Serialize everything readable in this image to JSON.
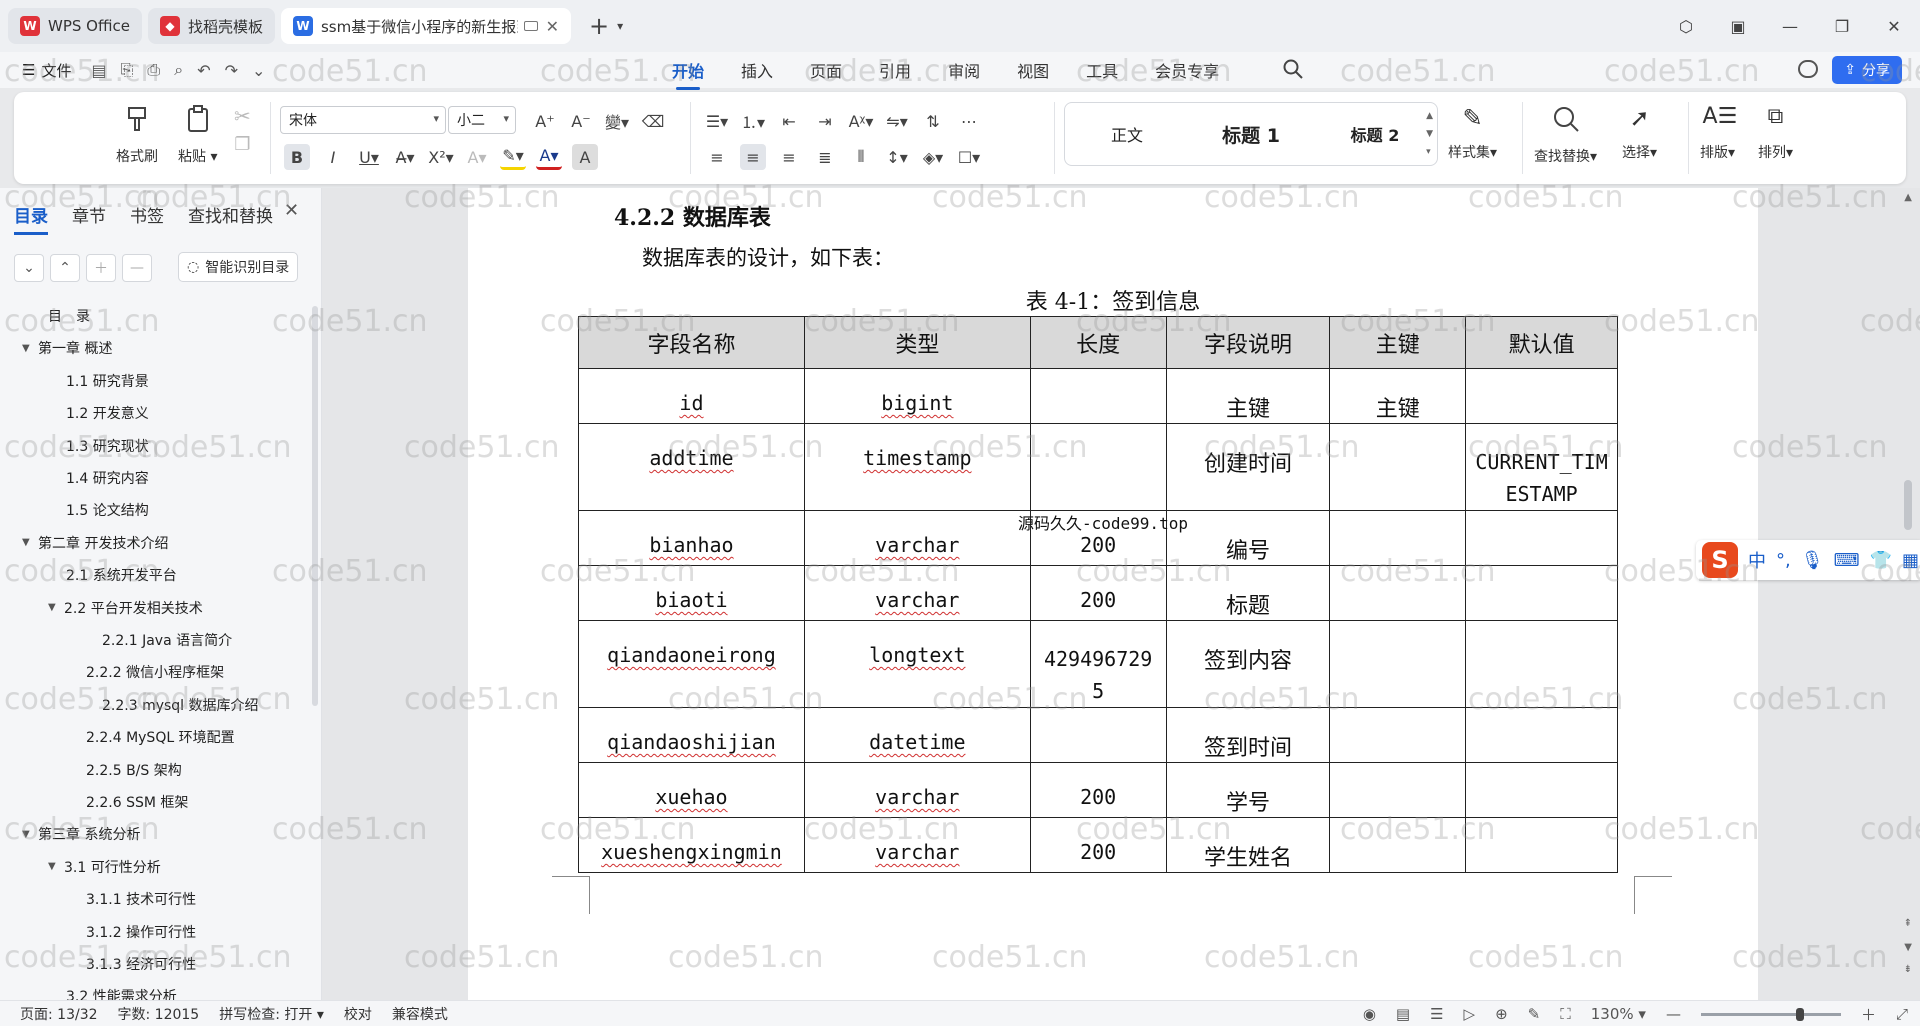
{
  "tabs": [
    {
      "title": "WPS Office",
      "icon_color": "#e0333a",
      "icon": "W"
    },
    {
      "title": "找稻壳模板",
      "icon_color": "#e0333a",
      "icon": "◆"
    },
    {
      "title": "ssm基于微信小程序的新生报到",
      "icon_color": "#2b6de3",
      "icon": "W"
    }
  ],
  "menu": {
    "file": "文件",
    "ribbon_tabs": [
      "开始",
      "插入",
      "页面",
      "引用",
      "审阅",
      "视图",
      "工具",
      "会员专享"
    ],
    "share": "分享"
  },
  "ribbon": {
    "format_painter": "格式刷",
    "paste": "粘贴",
    "font_name": "宋体",
    "font_size": "小二",
    "styles": [
      "正文",
      "标题 1",
      "标题 2"
    ],
    "style_set": "样式集",
    "find_replace": "查找替换",
    "select": "选择",
    "layout": "排版",
    "arrange": "排列"
  },
  "sidebar": {
    "tabs": [
      "目录",
      "章节",
      "书签",
      "查找和替换"
    ],
    "smart_toc": "智能识别目录",
    "toc": [
      {
        "label": "目　录",
        "level": 0,
        "arrow": ""
      },
      {
        "label": "第一章  概述",
        "level": 0,
        "arrow": "▼"
      },
      {
        "label": "1.1  研究背景",
        "level": 1,
        "arrow": ""
      },
      {
        "label": "1.2  开发意义",
        "level": 1,
        "arrow": ""
      },
      {
        "label": "1.3  研究现状",
        "level": 1,
        "arrow": ""
      },
      {
        "label": "1.4  研究内容",
        "level": 1,
        "arrow": ""
      },
      {
        "label": "1.5  论文结构",
        "level": 1,
        "arrow": ""
      },
      {
        "label": "第二章  开发技术介绍",
        "level": 0,
        "arrow": "▼"
      },
      {
        "label": "2.1  系统开发平台",
        "level": 1,
        "arrow": ""
      },
      {
        "label": "2.2  平台开发相关技术",
        "level": 1,
        "arrow": "▼"
      },
      {
        "label": "2.2.1    Java 语言简介",
        "level": 3,
        "arrow": ""
      },
      {
        "label": "2.2.2    微信小程序框架",
        "level": 2,
        "arrow": ""
      },
      {
        "label": "2.2.3    mysql 数据库介绍",
        "level": 3,
        "arrow": ""
      },
      {
        "label": "2.2.4    MySQL 环境配置",
        "level": 2,
        "arrow": ""
      },
      {
        "label": "2.2.5    B/S 架构",
        "level": 2,
        "arrow": ""
      },
      {
        "label": "2.2.6    SSM 框架",
        "level": 2,
        "arrow": ""
      },
      {
        "label": "第三章  系统分析",
        "level": 0,
        "arrow": "▼"
      },
      {
        "label": "3.1  可行性分析",
        "level": 1,
        "arrow": "▼"
      },
      {
        "label": "3.1.1  技术可行性",
        "level": 2,
        "arrow": ""
      },
      {
        "label": "3.1.2  操作可行性",
        "level": 2,
        "arrow": ""
      },
      {
        "label": "3.1.3  经济可行性",
        "level": 2,
        "arrow": ""
      },
      {
        "label": "3.2 性能需求分析",
        "level": 1,
        "arrow": ""
      }
    ]
  },
  "document": {
    "heading": "4.2.2  数据库表",
    "paragraph": "数据库表的设计，如下表：",
    "caption": "表 4-1：签到信息",
    "overlay_text": "源码久久-code99.top",
    "table": {
      "headers": [
        "字段名称",
        "类型",
        "长度",
        "字段说明",
        "主键",
        "默认值"
      ],
      "rows": [
        [
          "id",
          "bigint",
          "",
          "主键",
          "主键",
          ""
        ],
        [
          "addtime",
          "timestamp",
          "",
          "创建时间",
          "",
          "CURRENT_TIMESTAMP"
        ],
        [
          "bianhao",
          "varchar",
          "200",
          "编号",
          "",
          ""
        ],
        [
          "biaoti",
          "varchar",
          "200",
          "标题",
          "",
          ""
        ],
        [
          "qiandaoneirong",
          "longtext",
          "4294967295",
          "签到内容",
          "",
          ""
        ],
        [
          "qiandaoshijian",
          "datetime",
          "",
          "签到时间",
          "",
          ""
        ],
        [
          "xuehao",
          "varchar",
          "200",
          "学号",
          "",
          ""
        ],
        [
          "xueshengxingmin",
          "varchar",
          "200",
          "学生姓名",
          "",
          ""
        ]
      ]
    }
  },
  "ime": {
    "lang": "中",
    "punct": "°,"
  },
  "status": {
    "page": "页面: 13/32",
    "words": "字数: 12015",
    "spell": "拼写检查: 打开",
    "proofread": "校对",
    "compat": "兼容模式",
    "zoom": "130%",
    "zoom_level": 0.68
  },
  "watermark": "code51.cn"
}
